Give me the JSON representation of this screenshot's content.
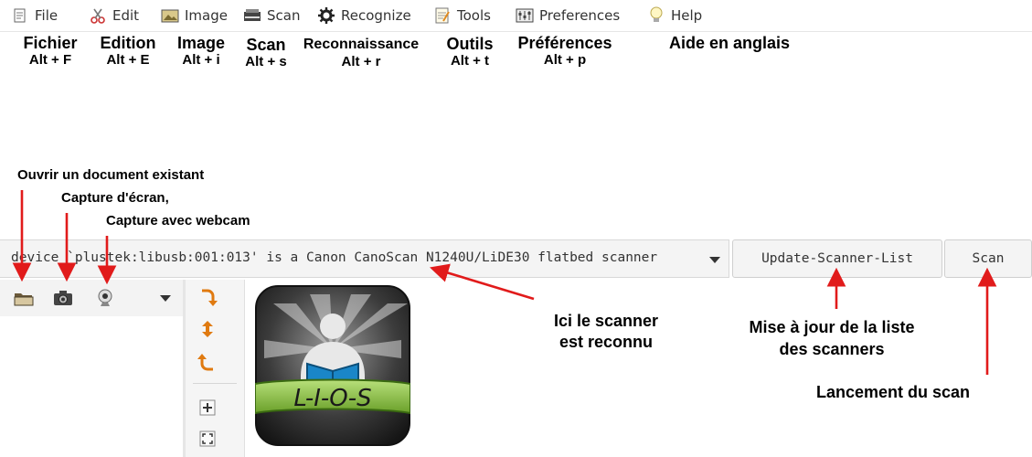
{
  "menu": [
    {
      "label": "File",
      "icon": "file-icon"
    },
    {
      "label": "Edit",
      "icon": "scissors-icon"
    },
    {
      "label": "Image",
      "icon": "image-icon"
    },
    {
      "label": "Scan",
      "icon": "scanner-icon"
    },
    {
      "label": "Recognize",
      "icon": "gear-icon"
    },
    {
      "label": "Tools",
      "icon": "notepad-icon"
    },
    {
      "label": "Preferences",
      "icon": "preferences-icon"
    },
    {
      "label": "Help",
      "icon": "lightbulb-icon"
    }
  ],
  "annotations": {
    "menu": [
      {
        "title": "Fichier",
        "keys": "Alt + F"
      },
      {
        "title": "Edition",
        "keys": "Alt + E"
      },
      {
        "title": "Image",
        "keys": "Alt + i"
      },
      {
        "title": "Scan",
        "keys": "Alt + s"
      },
      {
        "title": "Reconnaissance",
        "keys": "Alt + r"
      },
      {
        "title": "Outils",
        "keys": "Alt + t"
      },
      {
        "title": "Préférences",
        "keys": "Alt + p"
      },
      {
        "title": "Aide en anglais",
        "keys": ""
      }
    ],
    "open_document": "Ouvrir un document existant",
    "screenshot": "Capture d'écran,",
    "webcam": "Capture avec webcam",
    "scanner_recognized_line1": "Ici le scanner",
    "scanner_recognized_line2": "est reconnu",
    "update_list_line1": "Mise à jour de la liste",
    "update_list_line2": "des scanners",
    "launch_scan": "Lancement du scan"
  },
  "scanner": {
    "device_text": "device `plustek:libusb:001:013' is a Canon CanoScan N1240U/LiDE30 flatbed scanner",
    "update_button": "Update-Scanner-List",
    "scan_button": "Scan"
  },
  "left_toolbar": {
    "icons": [
      "open-folder-icon",
      "camera-icon",
      "webcam-icon",
      "dropdown-arrow-icon"
    ]
  },
  "image_toolbar": {
    "icons": [
      "rotate-right-icon",
      "rotate-180-icon",
      "rotate-left-icon",
      "zoom-in-icon",
      "zoom-fit-icon"
    ]
  },
  "logo": {
    "text": "L-I-O-S"
  },
  "colors": {
    "annotation_arrow": "#e11b1b",
    "logo_green": "#8fc43a",
    "book_blue": "#1a86c8"
  }
}
